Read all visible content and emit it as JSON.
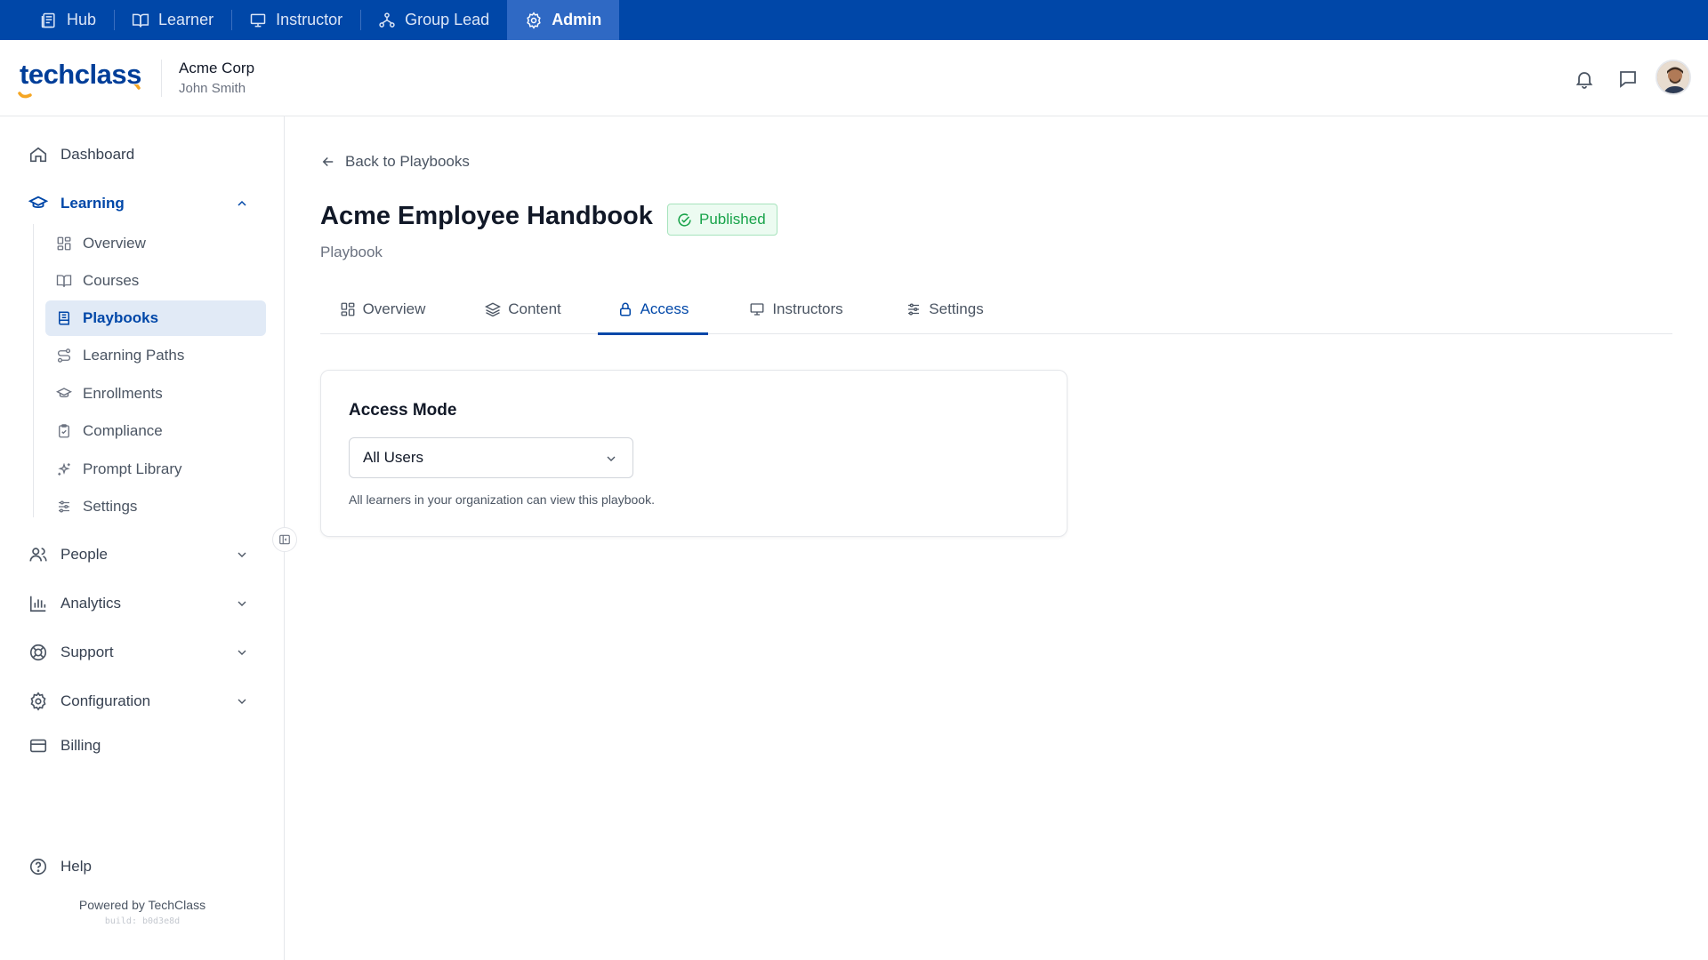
{
  "roles": [
    {
      "label": "Hub",
      "icon": "hub-icon"
    },
    {
      "label": "Learner",
      "icon": "book-open-icon"
    },
    {
      "label": "Instructor",
      "icon": "presentation-icon"
    },
    {
      "label": "Group Lead",
      "icon": "network-icon"
    },
    {
      "label": "Admin",
      "icon": "gear-icon",
      "active": true
    }
  ],
  "header": {
    "logo_text": "techclass",
    "org_name": "Acme Corp",
    "user_name": "John Smith"
  },
  "sidebar": {
    "dashboard": "Dashboard",
    "learning": "Learning",
    "learning_items": [
      {
        "label": "Overview",
        "icon": "grid-icon"
      },
      {
        "label": "Courses",
        "icon": "book-open-icon"
      },
      {
        "label": "Playbooks",
        "icon": "playbook-icon",
        "active": true
      },
      {
        "label": "Learning Paths",
        "icon": "route-icon"
      },
      {
        "label": "Enrollments",
        "icon": "graduation-cap-icon"
      },
      {
        "label": "Compliance",
        "icon": "clipboard-check-icon"
      },
      {
        "label": "Prompt Library",
        "icon": "sparkles-icon"
      },
      {
        "label": "Settings",
        "icon": "sliders-icon"
      }
    ],
    "people": "People",
    "analytics": "Analytics",
    "support": "Support",
    "configuration": "Configuration",
    "billing": "Billing",
    "help": "Help",
    "powered_by": "Powered by TechClass",
    "build": "build: b0d3e8d"
  },
  "main": {
    "back_label": "Back to Playbooks",
    "title": "Acme Employee Handbook",
    "status_badge": "Published",
    "subtitle": "Playbook",
    "tabs": [
      {
        "label": "Overview",
        "icon": "grid-icon"
      },
      {
        "label": "Content",
        "icon": "layers-icon"
      },
      {
        "label": "Access",
        "icon": "lock-icon",
        "active": true
      },
      {
        "label": "Instructors",
        "icon": "presentation-icon"
      },
      {
        "label": "Settings",
        "icon": "sliders-icon"
      }
    ],
    "access_card": {
      "title": "Access Mode",
      "select_value": "All Users",
      "help_text": "All learners in your organization can view this playbook."
    }
  },
  "colors": {
    "brand": "#0047a8",
    "active_role_bg": "#2f69c4",
    "published_green": "#18a34a",
    "logo_accent": "#f5a623"
  }
}
